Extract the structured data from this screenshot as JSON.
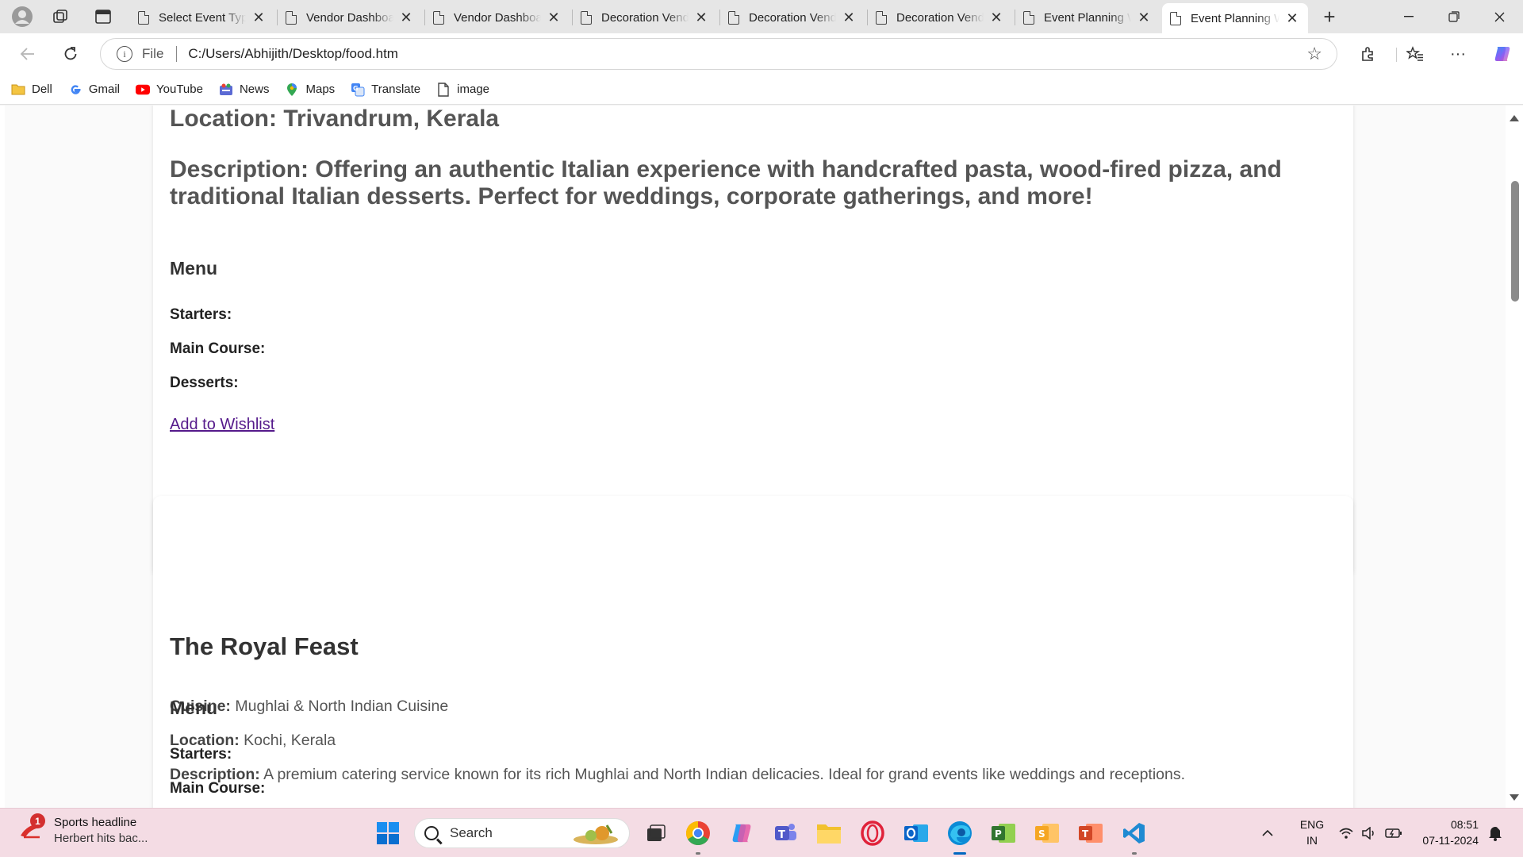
{
  "browser": {
    "tabs": [
      {
        "title": "Select Event Type",
        "active": false
      },
      {
        "title": "Vendor Dashboard",
        "active": false
      },
      {
        "title": "Vendor Dashboard",
        "active": false
      },
      {
        "title": "Decoration Vendor",
        "active": false
      },
      {
        "title": "Decoration Vendor",
        "active": false
      },
      {
        "title": "Decoration Vendor",
        "active": false
      },
      {
        "title": "Event Planning Website",
        "active": false
      },
      {
        "title": "Event Planning Website",
        "active": true
      }
    ],
    "address": {
      "scheme_label": "File",
      "url": "C:/Users/Abhijith/Desktop/food.htm"
    },
    "favorites": [
      {
        "label": "Dell",
        "icon": "folder-icon",
        "color": "#e8b52e"
      },
      {
        "label": "Gmail",
        "icon": "google-icon",
        "color": "#4285f4"
      },
      {
        "label": "YouTube",
        "icon": "youtube-icon",
        "color": "#ff0000"
      },
      {
        "label": "News",
        "icon": "news-icon",
        "color": "#5b6ad4"
      },
      {
        "label": "Maps",
        "icon": "maps-pin-icon",
        "color": "#34a853"
      },
      {
        "label": "Translate",
        "icon": "translate-icon",
        "color": "#4285f4"
      },
      {
        "label": "image",
        "icon": "page-icon",
        "color": "#444444"
      }
    ]
  },
  "page": {
    "card1": {
      "location": "Location: Trivandrum, Kerala",
      "description": "Description: Offering an authentic Italian experience with handcrafted pasta, wood-fired pizza, and traditional Italian desserts. Perfect for weddings, corporate gatherings, and more!",
      "menu_heading": "Menu",
      "starters_label": "Starters:",
      "main_course_label": "Main Course:",
      "desserts_label": "Desserts:",
      "wishlist_link": "Add to Wishlist"
    },
    "card2": {
      "name": "The Royal Feast",
      "cuisine_label": "Cuisine:",
      "cuisine": "Mughlai & North Indian Cuisine",
      "location_label": "Location:",
      "location": "Kochi, Kerala",
      "description_label": "Description:",
      "description": "A premium catering service known for its rich Mughlai and North Indian delicacies. Ideal for grand events like weddings and receptions.",
      "menu_heading": "Menu",
      "starters_label": "Starters:",
      "main_course_label": "Main Course:"
    },
    "scroll_position": 0.12
  },
  "taskbar": {
    "news": {
      "badge": "1",
      "title": "Sports headline",
      "subtitle": "Herbert hits bac..."
    },
    "search_placeholder": "Search",
    "apps": [
      {
        "name": "start-button",
        "color": "#0078d4"
      },
      {
        "name": "task-view",
        "color": "#333333"
      },
      {
        "name": "chrome",
        "color": "#ea4335"
      },
      {
        "name": "copilot",
        "color": "#8a5cf6"
      },
      {
        "name": "teams",
        "color": "#5059c9"
      },
      {
        "name": "file-explorer",
        "color": "#f2c12e"
      },
      {
        "name": "opera",
        "color": "#e0223a"
      },
      {
        "name": "outlook",
        "color": "#0a64c8"
      },
      {
        "name": "edge",
        "color": "#0c8bd6"
      },
      {
        "name": "project",
        "color": "#31752f"
      },
      {
        "name": "sway",
        "color": "#f5a623"
      },
      {
        "name": "powerpoint",
        "color": "#d24726"
      },
      {
        "name": "vscode",
        "color": "#1f8ad2"
      }
    ],
    "lang_line1": "ENG",
    "lang_line2": "IN",
    "time": "08:51",
    "date": "07-11-2024"
  }
}
